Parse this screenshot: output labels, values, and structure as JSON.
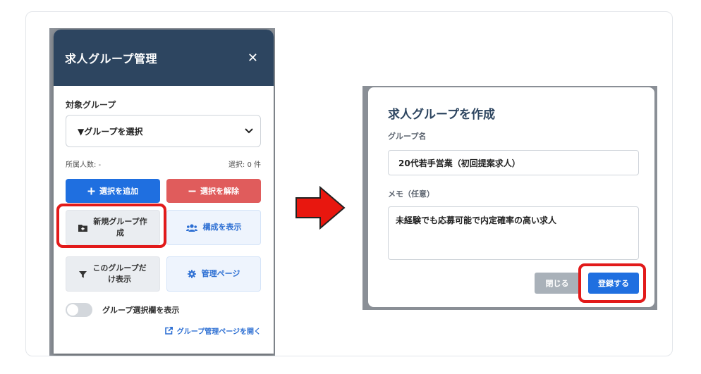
{
  "left_panel": {
    "title": "求人グループ管理",
    "close_label": "✕",
    "target_group_label": "対象グループ",
    "group_select_value": "▼グループを選択",
    "member_count_text": "所属人数: -",
    "selected_count_text": "選択: 0 件",
    "add_selection_label": "選択を追加",
    "remove_selection_label": "選択を解除",
    "new_group_label_line1": "新規グループ作",
    "new_group_label_line2": "成",
    "show_structure_label": "構成を表示",
    "filter_label_line1": "このグループだ",
    "filter_label_line2": "け表示",
    "manage_page_label": "管理ページ",
    "toggle_label": "グループ選択欄を表示",
    "open_manage_link": "グループ管理ページを開く"
  },
  "dialog": {
    "title": "求人グループを作成",
    "group_name_label": "グループ名",
    "group_name_value": "20代若手営業（初回提案求人）",
    "memo_label": "メモ（任意）",
    "memo_value": "未経験でも応募可能で内定確率の高い求人",
    "close_label": "閉じる",
    "register_label": "登録する"
  },
  "colors": {
    "header_navy": "#2d4560",
    "primary_blue": "#1f6fe0",
    "danger_red": "#e05c5c",
    "highlight_red": "#e21a1a",
    "arrow_red": "#e8170f"
  },
  "icons": [
    "close-icon",
    "chevron-down-icon",
    "plus-icon",
    "minus-icon",
    "folder-plus-icon",
    "users-icon",
    "filter-icon",
    "gear-icon",
    "external-link-icon",
    "arrow-right-icon"
  ]
}
